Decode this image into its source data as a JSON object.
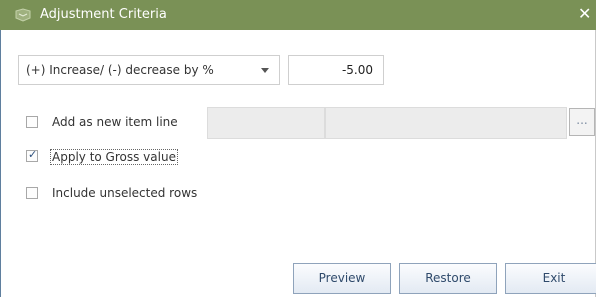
{
  "window": {
    "title": "Adjustment Criteria",
    "icon": "dialog-icon",
    "close_glyph": "✕",
    "title_bar_color": "#7a9156"
  },
  "adjustment": {
    "mode_selected": "(+) Increase/ (-) decrease by %",
    "value": "-5.00"
  },
  "options": {
    "add_new_line": {
      "label": "Add as new item line",
      "checked": false,
      "browse_label": "..."
    },
    "apply_gross": {
      "label": "Apply to Gross value",
      "checked": true
    },
    "include_unselected": {
      "label": "Include unselected rows",
      "checked": false
    }
  },
  "buttons": {
    "preview": "Preview",
    "restore": "Restore",
    "exit": "Exit"
  }
}
